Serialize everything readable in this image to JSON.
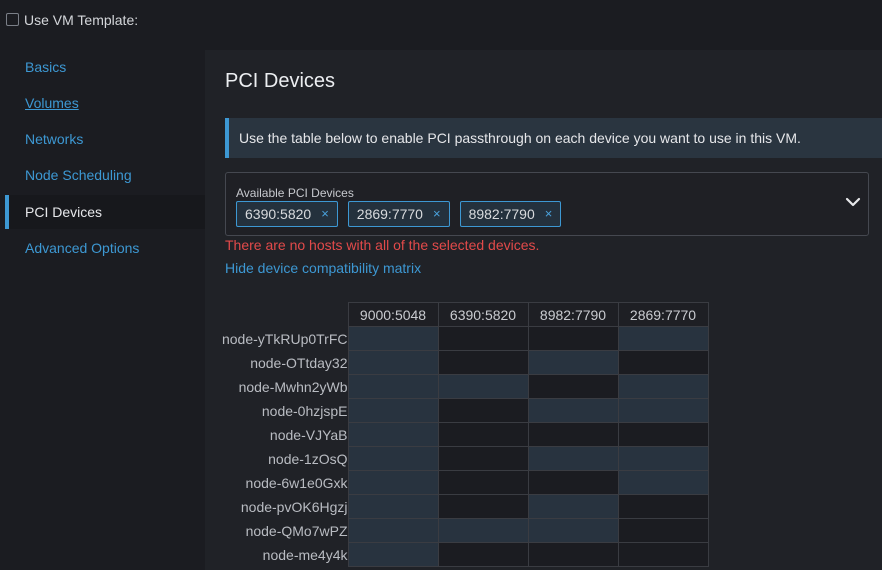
{
  "top": {
    "use_vm_template_label": "Use VM Template:"
  },
  "sidebar": {
    "items": [
      {
        "label": "Basics"
      },
      {
        "label": "Volumes"
      },
      {
        "label": "Networks"
      },
      {
        "label": "Node Scheduling"
      },
      {
        "label": "PCI Devices"
      },
      {
        "label": "Advanced Options"
      }
    ],
    "active": "PCI Devices"
  },
  "main": {
    "title": "PCI Devices",
    "banner": "Use the table below to enable PCI passthrough on each device you want to use in this VM.",
    "select": {
      "label": "Available PCI Devices",
      "chips": [
        "6390:5820",
        "2869:7770",
        "8982:7790"
      ],
      "remove_glyph": "×"
    },
    "error": "There are no hosts with all of the selected devices.",
    "toggle_link": "Hide device compatibility matrix"
  },
  "matrix": {
    "columns": [
      "9000:5048",
      "6390:5820",
      "8982:7790",
      "2869:7770"
    ],
    "rows": [
      {
        "node": "node-yTkRUp0TrFC",
        "cells": [
          true,
          false,
          false,
          true
        ]
      },
      {
        "node": "node-OTtday32",
        "cells": [
          true,
          false,
          true,
          false
        ]
      },
      {
        "node": "node-Mwhn2yWb",
        "cells": [
          true,
          true,
          false,
          true
        ]
      },
      {
        "node": "node-0hzjspE",
        "cells": [
          true,
          false,
          true,
          true
        ]
      },
      {
        "node": "node-VJYaB",
        "cells": [
          true,
          false,
          false,
          false
        ]
      },
      {
        "node": "node-1zOsQ",
        "cells": [
          true,
          false,
          true,
          true
        ]
      },
      {
        "node": "node-6w1e0Gxk",
        "cells": [
          true,
          false,
          false,
          true
        ]
      },
      {
        "node": "node-pvOK6Hgzj",
        "cells": [
          true,
          false,
          true,
          false
        ]
      },
      {
        "node": "node-QMo7wPZ",
        "cells": [
          true,
          true,
          true,
          false
        ]
      },
      {
        "node": "node-me4y4k",
        "cells": [
          true,
          false,
          false,
          false
        ]
      }
    ]
  },
  "colors": {
    "accent": "#3d98d3",
    "error": "#e24a4a",
    "cell_on": "#28333f"
  }
}
